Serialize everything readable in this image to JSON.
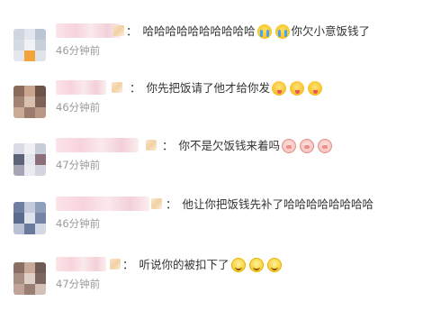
{
  "comments": [
    {
      "colon": "：",
      "text": "哈哈哈哈哈哈哈哈哈哈",
      "emojis_before": [
        "crying-face-icon",
        "crying-face-icon"
      ],
      "text_after": "你欠小意饭钱了",
      "time": "46分钟前",
      "name_width": 72,
      "avatar_colors": [
        "#cfd6e0",
        "#e3e6ec",
        "#bcc5d3",
        "#d5dbe5",
        "#f0f2f5",
        "#c7cfdb",
        "#e4e8ee",
        "#f2a43a",
        "#dfe3ea"
      ]
    },
    {
      "colon": "：",
      "text": "你先把饭请了他才给你发",
      "emojis_after": [
        "tongue-face-icon",
        "tongue-face-icon",
        "tongue-face-icon"
      ],
      "time": "46分钟前",
      "name_width": 56,
      "avatar_colors": [
        "#8a6a5a",
        "#c9a58e",
        "#6d5247",
        "#a38374",
        "#d8bfae",
        "#7e6257",
        "#caa996",
        "#9c7b6d",
        "#b89784"
      ]
    },
    {
      "colon": "：",
      "text": "你不是欠饭钱来着吗",
      "emojis_after": [
        "pig-face-icon",
        "pig-face-icon",
        "pig-face-icon"
      ],
      "time": "47分钟前",
      "name_width": 92,
      "avatar_colors": [
        "#d9dce6",
        "#eef0f4",
        "#c8ccd8",
        "#5d6479",
        "#e4e6ee",
        "#8c6f7a",
        "#a7a4b6",
        "#e9ebf1",
        "#d3d6e1"
      ]
    },
    {
      "colon": "：",
      "text": "他让你把饭钱先补了哈哈哈哈哈哈哈哈",
      "time": "46分钟前",
      "name_width": 104,
      "avatar_colors": [
        "#6e7fa2",
        "#c4ccdb",
        "#8fa0bd",
        "#5b6b8e",
        "#dfe3ec",
        "#7384a6",
        "#b8c1d3",
        "#6a7a9c",
        "#d2d8e4"
      ]
    },
    {
      "colon": "：",
      "text": "听说你的被扣下了",
      "emojis_after": [
        "smile-face-icon",
        "smile-face-icon",
        "smile-face-icon"
      ],
      "time": "47分钟前",
      "name_width": 56,
      "avatar_colors": [
        "#8c6f64",
        "#c8a99a",
        "#6f5b55",
        "#a88d82",
        "#e0cfc7",
        "#7b6660",
        "#bfa497",
        "#9a7f75",
        "#d4c0b6"
      ]
    }
  ]
}
